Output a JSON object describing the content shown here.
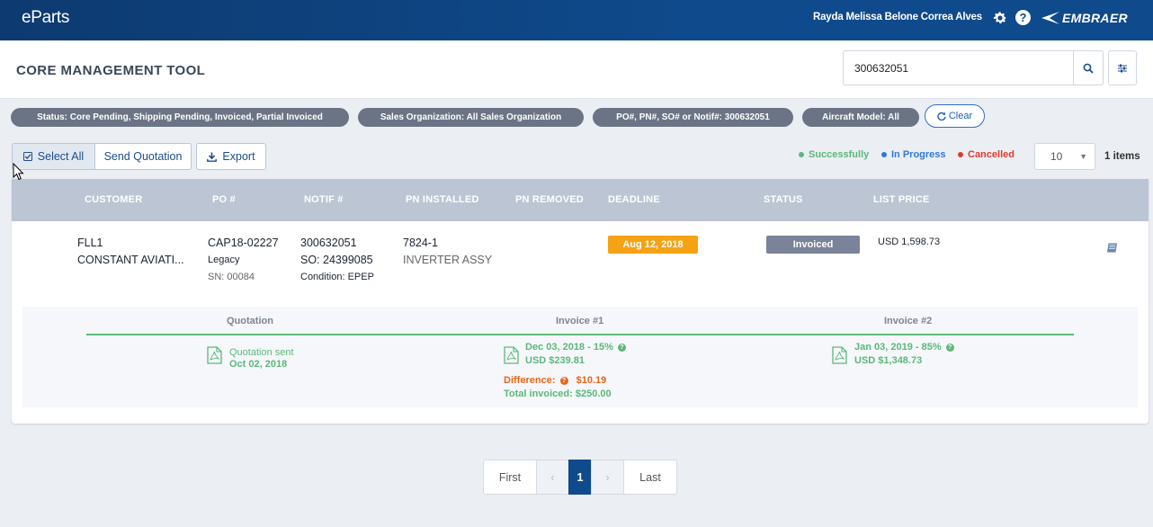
{
  "app": {
    "logo": "eParts",
    "user_name": "Rayda Melissa Belone Correa Alves",
    "brand": "EMBRAER"
  },
  "header": {
    "title": "CORE MANAGEMENT TOOL",
    "search_value": "300632051"
  },
  "filters": {
    "chips": [
      "Status: Core Pending, Shipping Pending, Invoiced, Partial Invoiced",
      "Sales Organization: All Sales Organization",
      "PO#, PN#, SO# or Notif#: 300632051",
      "Aircraft Model: All"
    ],
    "clear_label": "Clear"
  },
  "toolbar": {
    "select_all": "Select All",
    "send_quotation": "Send Quotation",
    "export": "Export"
  },
  "legend": {
    "successfully": "Successfully",
    "in_progress": "In Progress",
    "cancelled": "Cancelled",
    "colors": {
      "successfully": "#5cb87a",
      "in_progress": "#2f79d8",
      "cancelled": "#e03a2f"
    }
  },
  "paging": {
    "page_size": "10",
    "items_count": "1 items",
    "first": "First",
    "prev": "‹",
    "current": "1",
    "next": "›",
    "last": "Last"
  },
  "table": {
    "columns": [
      "CUSTOMER",
      "PO #",
      "NOTIF #",
      "PN INSTALLED",
      "PN REMOVED",
      "DEADLINE",
      "STATUS",
      "LIST PRICE"
    ],
    "row": {
      "customer_code": "FLL1",
      "customer_name": "CONSTANT AVIATI...",
      "po": "CAP18-02227",
      "po_type": "Legacy",
      "sn": "SN: 00084",
      "notif": "300632051",
      "so": "SO: 24399085",
      "condition": "Condition: EPEP",
      "pn_installed": "7824-1",
      "pn_description": "INVERTER ASSY",
      "deadline": "Aug 12, 2018",
      "status": "Invoiced",
      "list_price": "USD 1,598.73"
    }
  },
  "invoice_panel": {
    "quotation": {
      "header": "Quotation",
      "line1": "Quotation sent",
      "line2": "Oct 02, 2018"
    },
    "invoice1": {
      "header": "Invoice #1",
      "line1": "Dec 03, 2018 - 15%",
      "line2": "USD $239.81",
      "difference_label": "Difference:",
      "difference_value": "$10.19",
      "total_label": "Total invoiced:",
      "total_value": "$250.00"
    },
    "invoice2": {
      "header": "Invoice #2",
      "line1": "Jan 03, 2019 - 85%",
      "line2": "USD $1,348.73"
    }
  }
}
